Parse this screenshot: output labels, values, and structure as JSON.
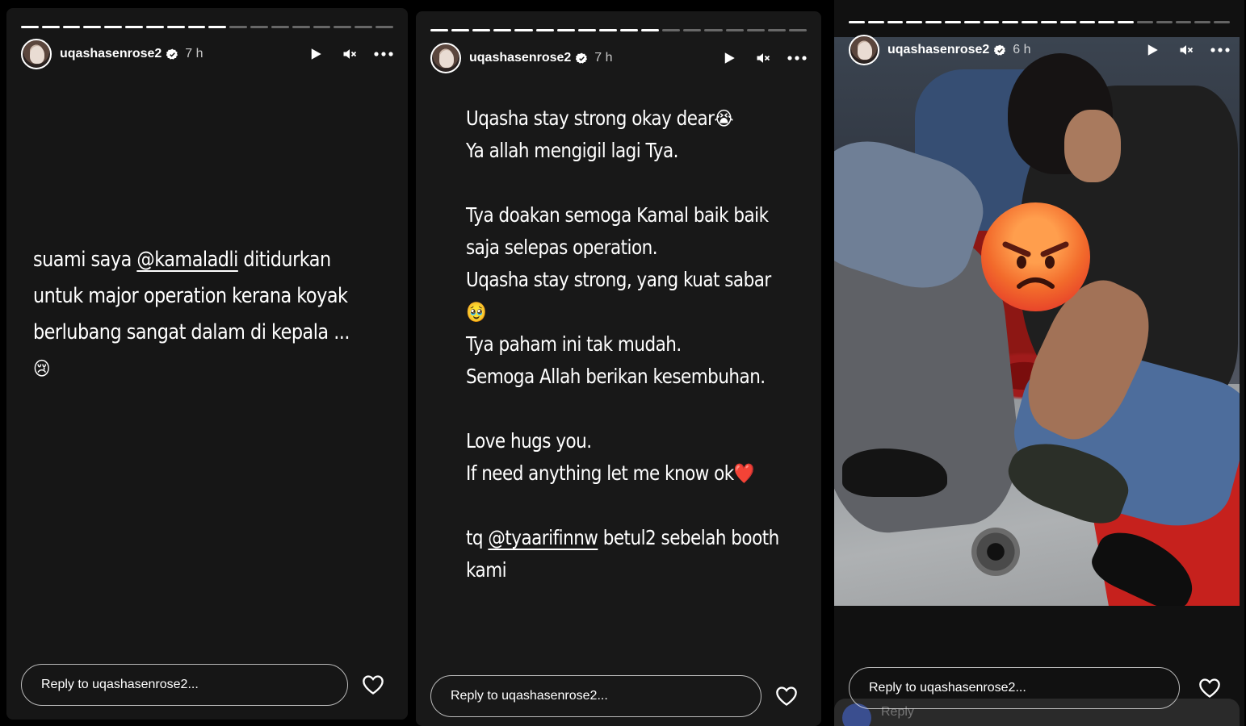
{
  "stories": [
    {
      "username": "uqashasenrose2",
      "time": "7 h",
      "progress_segments": 18,
      "progress_done": 10,
      "text_lines": [
        {
          "parts": [
            {
              "t": "suami saya "
            },
            {
              "t": "@kamaladli",
              "mention": true
            },
            {
              "t": " ditidurkan"
            }
          ]
        },
        {
          "parts": [
            {
              "t": "untuk major operation kerana koyak"
            }
          ]
        },
        {
          "parts": [
            {
              "t": "berlubang sangat dalam di kepala ..."
            }
          ]
        },
        {
          "parts": [
            {
              "t": "😢",
              "emoji": true
            }
          ]
        }
      ],
      "reply_placeholder": "Reply to uqashasenrose2..."
    },
    {
      "username": "uqashasenrose2",
      "time": "7 h",
      "progress_segments": 18,
      "progress_done": 11,
      "text_lines": [
        {
          "parts": [
            {
              "t": "Uqasha stay strong okay dear"
            },
            {
              "t": "😭",
              "emoji": true
            }
          ]
        },
        {
          "parts": [
            {
              "t": "Ya allah mengigil lagi Tya."
            }
          ]
        },
        {
          "gap": true
        },
        {
          "parts": [
            {
              "t": "Tya doakan semoga Kamal baik baik"
            }
          ]
        },
        {
          "parts": [
            {
              "t": "saja selepas operation."
            }
          ]
        },
        {
          "parts": [
            {
              "t": "Uqasha stay strong, yang kuat sabar"
            }
          ]
        },
        {
          "parts": [
            {
              "t": "🥹",
              "emoji": true
            }
          ]
        },
        {
          "parts": [
            {
              "t": "Tya paham ini tak mudah."
            }
          ]
        },
        {
          "parts": [
            {
              "t": "Semoga Allah berikan kesembuhan."
            }
          ]
        },
        {
          "gap": true
        },
        {
          "parts": [
            {
              "t": "Love hugs you."
            }
          ]
        },
        {
          "parts": [
            {
              "t": "If need anything let me know ok"
            },
            {
              "t": "❤️",
              "emoji": true
            }
          ]
        },
        {
          "gap": true
        },
        {
          "parts": [
            {
              "t": "tq "
            },
            {
              "t": "@tyaarifinnw",
              "mention": true
            },
            {
              "t": " betul2 sebelah booth"
            }
          ]
        },
        {
          "parts": [
            {
              "t": "kami"
            }
          ]
        }
      ],
      "reply_placeholder": "Reply to uqashasenrose2..."
    },
    {
      "username": "uqashasenrose2",
      "time": "6 h",
      "progress_segments": 20,
      "progress_done": 15,
      "sticker": "angry-face-emoji",
      "reply_placeholder": "Reply to uqashasenrose2...",
      "faded_reply_label": "Reply"
    }
  ],
  "icons": {
    "play": "play-icon",
    "mute": "muted-speaker-icon",
    "more": "more-options-icon",
    "like": "heart-icon",
    "verified": "verified-badge-icon"
  },
  "colors": {
    "background": "#000000",
    "story_bg": "#171717",
    "text": "#ffffff",
    "mat_red": "#c6211d"
  }
}
